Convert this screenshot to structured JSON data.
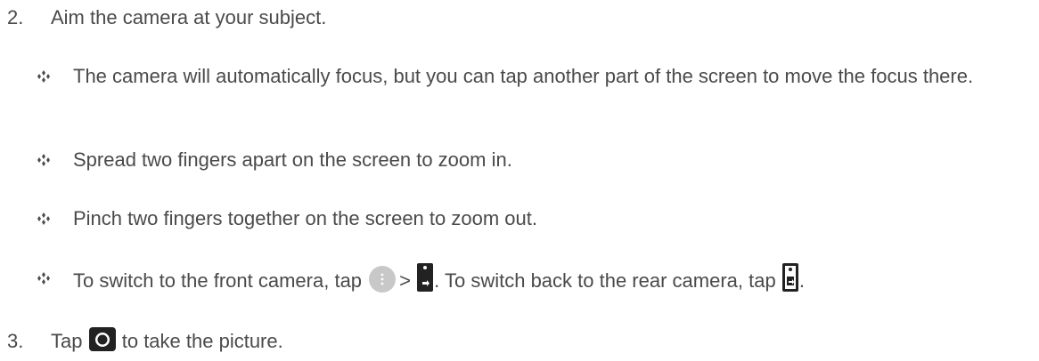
{
  "steps": [
    {
      "number": "2.",
      "text": "Aim the camera at your subject."
    },
    {
      "number": "3.",
      "text_before": "Tap",
      "text_after": "to take the picture."
    }
  ],
  "bullets": [
    {
      "text": "The camera will automatically focus, but you can tap another part of the screen to move the focus there."
    },
    {
      "text": "Spread two fingers apart on the screen to zoom in."
    },
    {
      "text": "Pinch two fingers together on the screen to zoom out."
    },
    {
      "text_part1": "To switch to the front camera, tap",
      "separator": ">",
      "text_part2": ". To switch back to the rear camera, tap",
      "text_end": "."
    }
  ],
  "icons": {
    "bullet": "diamond-bullet-icon",
    "menu": "menu-more-icon",
    "front_camera": "switch-front-camera-icon",
    "rear_camera": "switch-rear-camera-icon",
    "shutter": "camera-shutter-icon"
  },
  "colors": {
    "text": "#4a4a4a",
    "menu_icon": "#c8c8c8",
    "camera_icon": "#222222"
  }
}
